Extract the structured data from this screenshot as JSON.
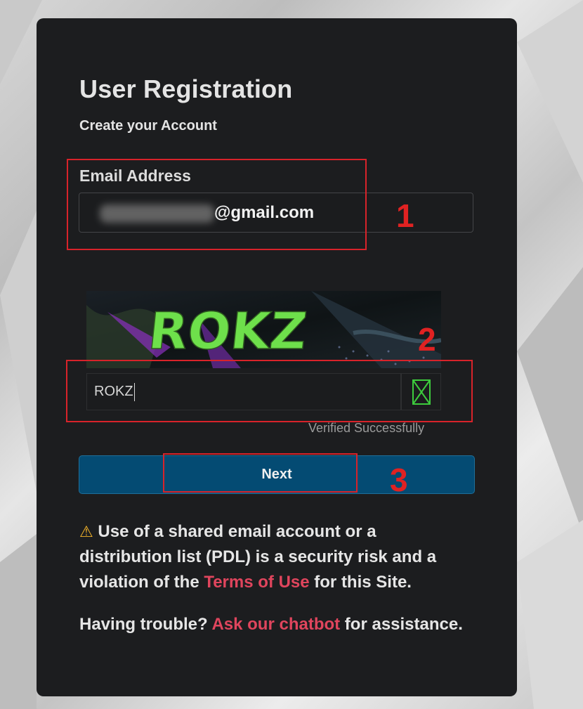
{
  "form": {
    "title": "User Registration",
    "subtitle": "Create your Account",
    "email_label": "Email Address",
    "email_value_visible": "@gmail.com",
    "captcha_text": "ROKZ",
    "captcha_input_value": "ROKZ",
    "verified_text": "Verified Successfully",
    "next_label": "Next"
  },
  "notice": {
    "warning_icon": "⚠",
    "warning_text_1": "Use of a shared email account or a distribution list (PDL) is a security risk and a violation of the ",
    "terms_link": "Terms of Use",
    "warning_text_2": " for this Site.",
    "trouble_text_1": "Having trouble? ",
    "chatbot_link": "Ask our chatbot",
    "trouble_text_2": " for assistance."
  },
  "annotations": {
    "step1": "1",
    "step2": "2",
    "step3": "3"
  },
  "colors": {
    "card_bg": "#1c1d1f",
    "button_bg": "#044b73",
    "link": "#e0455d",
    "annotation_red": "#d8232a",
    "captcha_green": "#6ee04b"
  }
}
